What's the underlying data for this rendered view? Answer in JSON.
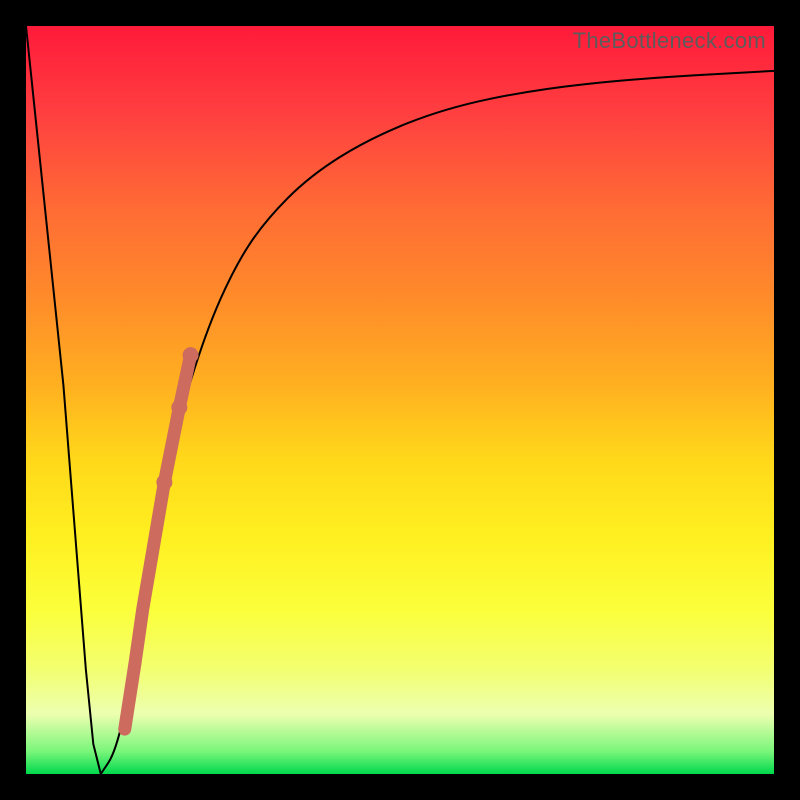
{
  "watermark": "TheBottleneck.com",
  "chart_data": {
    "type": "line",
    "title": "",
    "xlabel": "",
    "ylabel": "",
    "xlim": [
      0,
      100
    ],
    "ylim": [
      0,
      100
    ],
    "series": [
      {
        "name": "bottleneck-curve",
        "x": [
          0,
          5,
          8,
          9,
          10,
          12,
          14,
          16,
          18,
          20,
          24,
          28,
          32,
          38,
          46,
          56,
          68,
          82,
          100
        ],
        "values": [
          100,
          52,
          14,
          4,
          0,
          3,
          12,
          24,
          36,
          46,
          59,
          68,
          74,
          80,
          85,
          89,
          91.5,
          93,
          94
        ]
      }
    ],
    "markers": {
      "name": "highlight-segment",
      "points": [
        {
          "x": 13.2,
          "y": 6.0,
          "r": 5
        },
        {
          "x": 14.6,
          "y": 15.0,
          "r": 5
        },
        {
          "x": 15.6,
          "y": 22.0,
          "r": 4
        },
        {
          "x": 16.8,
          "y": 29.0,
          "r": 5
        },
        {
          "x": 18.5,
          "y": 39.0,
          "r": 8
        },
        {
          "x": 20.5,
          "y": 49.0,
          "r": 8
        },
        {
          "x": 22.0,
          "y": 56.0,
          "r": 8
        }
      ],
      "color": "#cc6b5e"
    },
    "colors": {
      "curve": "#000000",
      "background_top": "#ff1a3a",
      "background_bottom": "#00d94d",
      "frame": "#000000",
      "marker": "#cc6b5e"
    }
  }
}
